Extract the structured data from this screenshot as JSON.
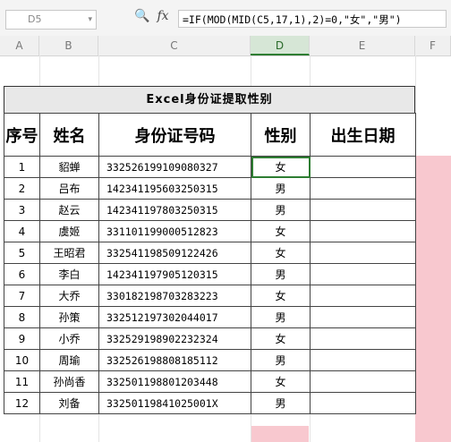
{
  "formula_bar": {
    "cell_ref": "D5",
    "formula": "=IF(MOD(MID(C5,17,1),2)=0,\"女\",\"男\")"
  },
  "columns": [
    "A",
    "B",
    "C",
    "D",
    "E",
    "F"
  ],
  "sheet": {
    "title": "Excel身份证提取性别",
    "headers": [
      "序号",
      "姓名",
      "身份证号码",
      "性别",
      "出生日期"
    ],
    "rows": [
      {
        "no": "1",
        "name": "貂蝉",
        "id": "332526199109080327",
        "gender": "女"
      },
      {
        "no": "2",
        "name": "吕布",
        "id": "142341195603250315",
        "gender": "男"
      },
      {
        "no": "3",
        "name": "赵云",
        "id": "142341197803250315",
        "gender": "男"
      },
      {
        "no": "4",
        "name": "虞姬",
        "id": "331101199000512823",
        "gender": "女"
      },
      {
        "no": "5",
        "name": "王昭君",
        "id": "332541198509122426",
        "gender": "女"
      },
      {
        "no": "6",
        "name": "李白",
        "id": "142341197905120315",
        "gender": "男"
      },
      {
        "no": "7",
        "name": "大乔",
        "id": "330182198703283223",
        "gender": "女"
      },
      {
        "no": "8",
        "name": "孙策",
        "id": "332512197302044017",
        "gender": "男"
      },
      {
        "no": "9",
        "name": "小乔",
        "id": "332529198902232324",
        "gender": "女"
      },
      {
        "no": "10",
        "name": "周瑜",
        "id": "332526198808185112",
        "gender": "男"
      },
      {
        "no": "11",
        "name": "孙尚香",
        "id": "332501198801203448",
        "gender": "女"
      },
      {
        "no": "12",
        "name": "刘备",
        "id": "33250119841025001X",
        "gender": "男"
      }
    ]
  },
  "colors": {
    "highlight": "#f8c8cf",
    "active_border": "#2e7d32"
  }
}
